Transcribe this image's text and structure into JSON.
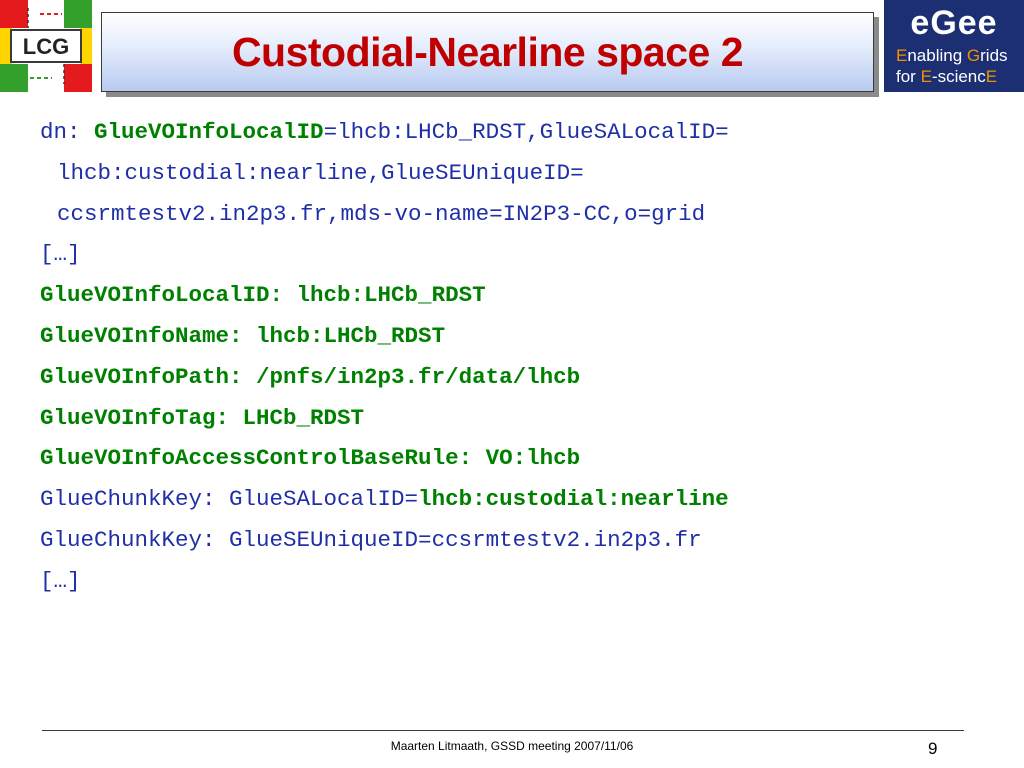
{
  "header": {
    "title": "Custodial-Nearline space 2",
    "left_logo_text": "LCG",
    "right_logo": {
      "wordmark": "eGee",
      "line1_e": "E",
      "line1_rest": "nabling ",
      "line1_g": "G",
      "line1_rest2": "rids",
      "line2_for": "for ",
      "line2_e": "E",
      "line2_mid": "-scienc",
      "line2_e2": "E"
    }
  },
  "lines": [
    {
      "segments": [
        {
          "text": "dn: ",
          "style": "b"
        },
        {
          "text": "GlueVOInfoLocalID",
          "style": "g"
        },
        {
          "text": "=lhcb:LHCb_RDST,GlueSALocalID=",
          "style": "b"
        }
      ]
    },
    {
      "indent": true,
      "segments": [
        {
          "text": "lhcb:custodial:nearline,GlueSEUniqueID=",
          "style": "b"
        }
      ]
    },
    {
      "indent": true,
      "segments": [
        {
          "text": "ccsrmtestv2.in2p3.fr,mds-vo-name=IN2P3-CC,o=grid",
          "style": "b"
        }
      ]
    },
    {
      "segments": [
        {
          "text": "[…]",
          "style": "b"
        }
      ]
    },
    {
      "segments": [
        {
          "text": "GlueVOInfoLocalID: lhcb:LHCb_RDST",
          "style": "g"
        }
      ]
    },
    {
      "segments": [
        {
          "text": "GlueVOInfoName: lhcb:LHCb_RDST",
          "style": "g"
        }
      ]
    },
    {
      "segments": [
        {
          "text": "GlueVOInfoPath: /pnfs/in2p3.fr/data/lhcb",
          "style": "g"
        }
      ]
    },
    {
      "segments": [
        {
          "text": "GlueVOInfoTag: LHCb_RDST",
          "style": "g"
        }
      ]
    },
    {
      "segments": [
        {
          "text": "GlueVOInfoAccessControlBaseRule: VO:lhcb",
          "style": "g"
        }
      ]
    },
    {
      "segments": [
        {
          "text": "GlueChunkKey: GlueSALocalID=",
          "style": "b"
        },
        {
          "text": "lhcb:custodial:nearline",
          "style": "g"
        }
      ]
    },
    {
      "segments": [
        {
          "text": "GlueChunkKey: GlueSEUniqueID=ccsrmtestv2.in2p3.fr",
          "style": "b"
        }
      ]
    },
    {
      "segments": [
        {
          "text": "[…]",
          "style": "b"
        }
      ]
    }
  ],
  "footer": {
    "text": "Maarten Litmaath, GSSD meeting 2007/11/06",
    "page_number": "9"
  },
  "colors": {
    "title": "#c00000",
    "code_blue": "#1f2fa6",
    "code_green": "#008000",
    "egee_bg": "#1c2f73",
    "egee_orange": "#f39200"
  }
}
